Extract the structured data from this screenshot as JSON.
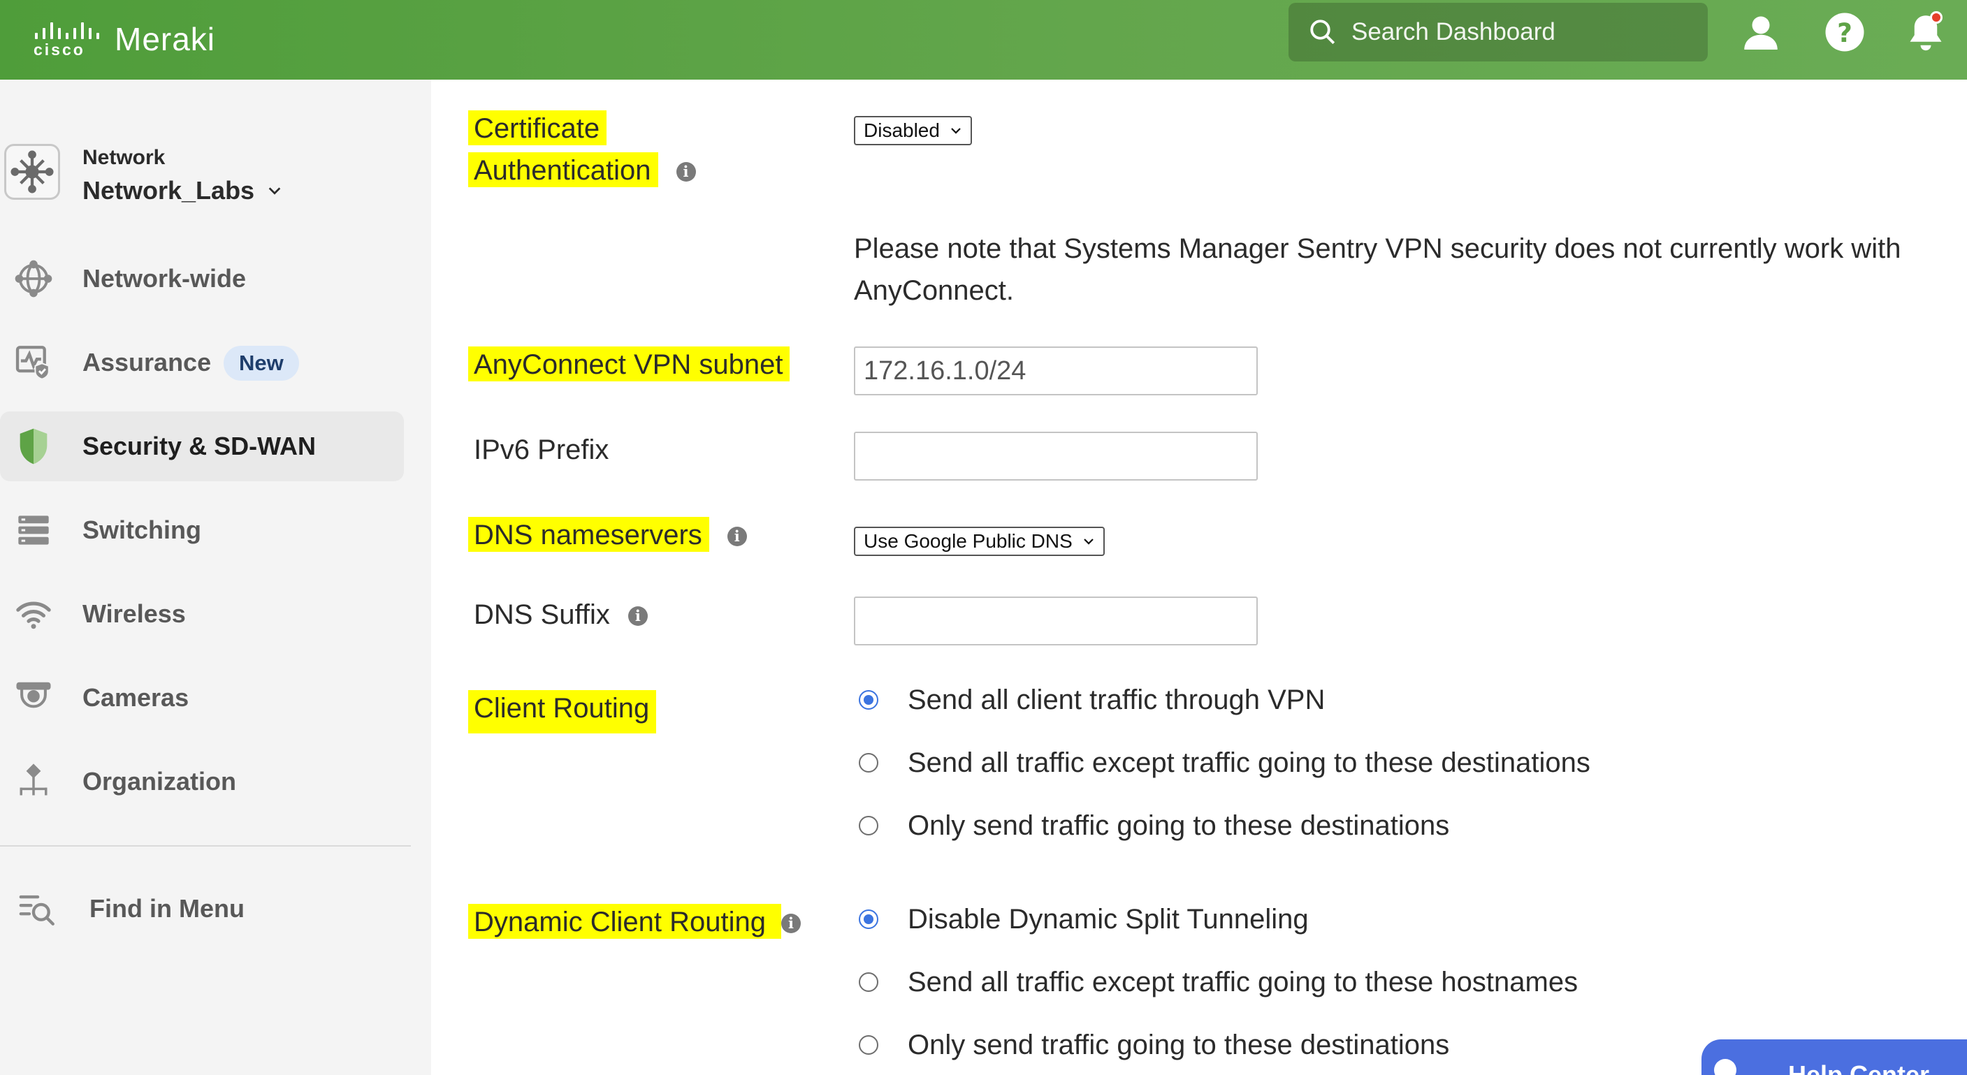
{
  "header": {
    "brand_cisco": "cisco",
    "brand_product": "Meraki",
    "search_placeholder": "Search Dashboard"
  },
  "sidebar": {
    "network_caption": "Network",
    "network_name": "Network_Labs",
    "items": [
      {
        "label": "Network-wide",
        "icon": "network-wide-icon"
      },
      {
        "label": "Assurance",
        "icon": "assurance-icon",
        "badge": "New"
      },
      {
        "label": "Security & SD-WAN",
        "icon": "security-shield-icon",
        "active": true
      },
      {
        "label": "Switching",
        "icon": "switching-icon"
      },
      {
        "label": "Wireless",
        "icon": "wireless-icon"
      },
      {
        "label": "Cameras",
        "icon": "camera-icon"
      },
      {
        "label": "Organization",
        "icon": "organization-icon"
      }
    ],
    "find_in_menu": "Find in Menu"
  },
  "form": {
    "cert_auth": {
      "label_line1": "Certificate",
      "label_line2": "Authentication",
      "value": "Disabled"
    },
    "note": "Please note that Systems Manager Sentry VPN security does not currently work with AnyConnect.",
    "subnet": {
      "label": "AnyConnect VPN subnet",
      "value": "172.16.1.0/24"
    },
    "ipv6": {
      "label": "IPv6 Prefix",
      "value": ""
    },
    "dns_ns": {
      "label": "DNS nameservers",
      "value": "Use Google Public DNS"
    },
    "dns_suffix": {
      "label": "DNS Suffix",
      "value": ""
    },
    "client_routing": {
      "label": "Client Routing",
      "options": [
        "Send all client traffic through VPN",
        "Send all traffic except traffic going to these destinations",
        "Only send traffic going to these destinations"
      ],
      "selected": 0
    },
    "dynamic_routing": {
      "label": "Dynamic Client Routing",
      "options": [
        "Disable Dynamic Split Tunneling",
        "Send all traffic except traffic going to these hostnames",
        "Only send traffic going to these destinations"
      ],
      "selected": 0
    }
  },
  "help_tab": {
    "label": "Help Center"
  },
  "colors": {
    "header_green": "#5ea346",
    "highlight": "#ffff00",
    "radio_blue": "#3b74e0",
    "badge_bg": "#dce8f8",
    "help_blue": "#4b6fe0"
  }
}
